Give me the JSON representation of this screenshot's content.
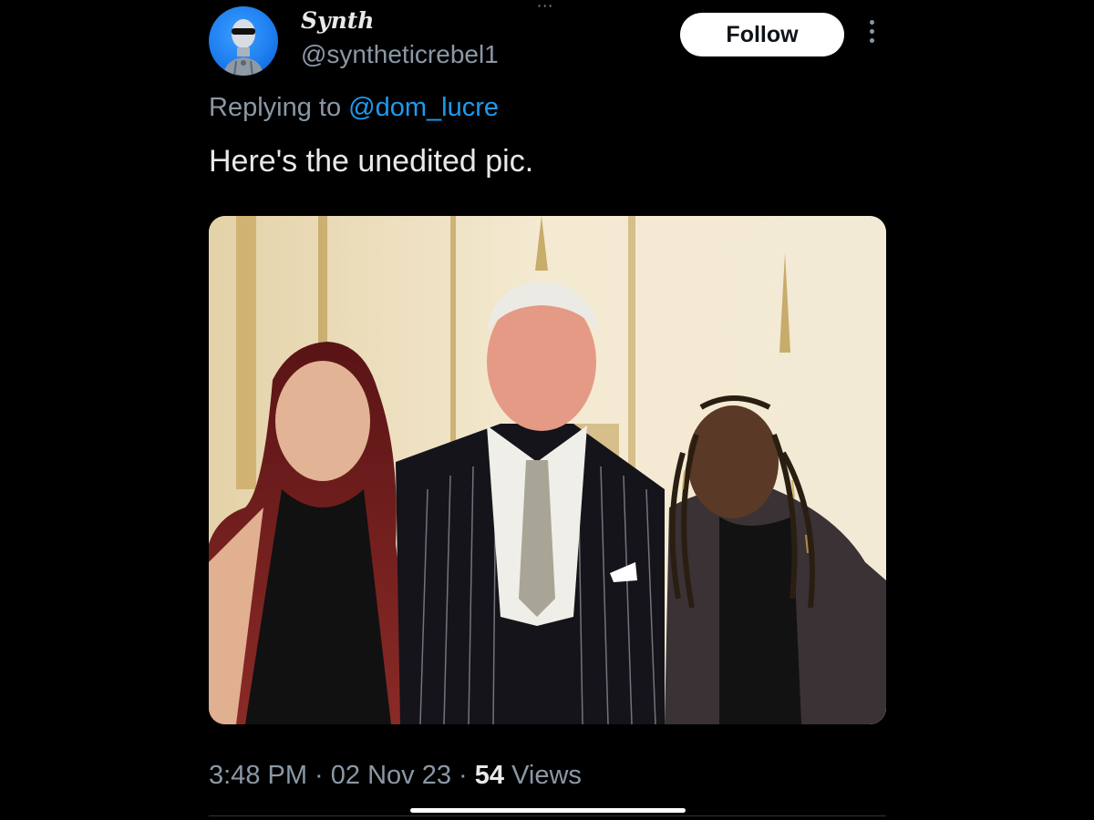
{
  "tweet": {
    "author": {
      "display_name": "Synth",
      "handle": "@syntheticrebel1",
      "avatar_icon": "robot-avatar-icon"
    },
    "top_overflow_label": "···",
    "follow_label": "Follow",
    "reply_prefix": "Replying to ",
    "reply_to": "@dom_lucre",
    "text": "Here's the unedited pic.",
    "media_icon": "photo-of-three-people",
    "time": "3:48 PM",
    "separator": " · ",
    "date": "02 Nov 23",
    "views_count": "54",
    "views_label": " Views"
  },
  "colors": {
    "background": "#000000",
    "primary_text": "#e7e9ea",
    "secondary_text": "#8b98a5",
    "link": "#1d9bf0",
    "follow_bg": "#ffffff"
  }
}
